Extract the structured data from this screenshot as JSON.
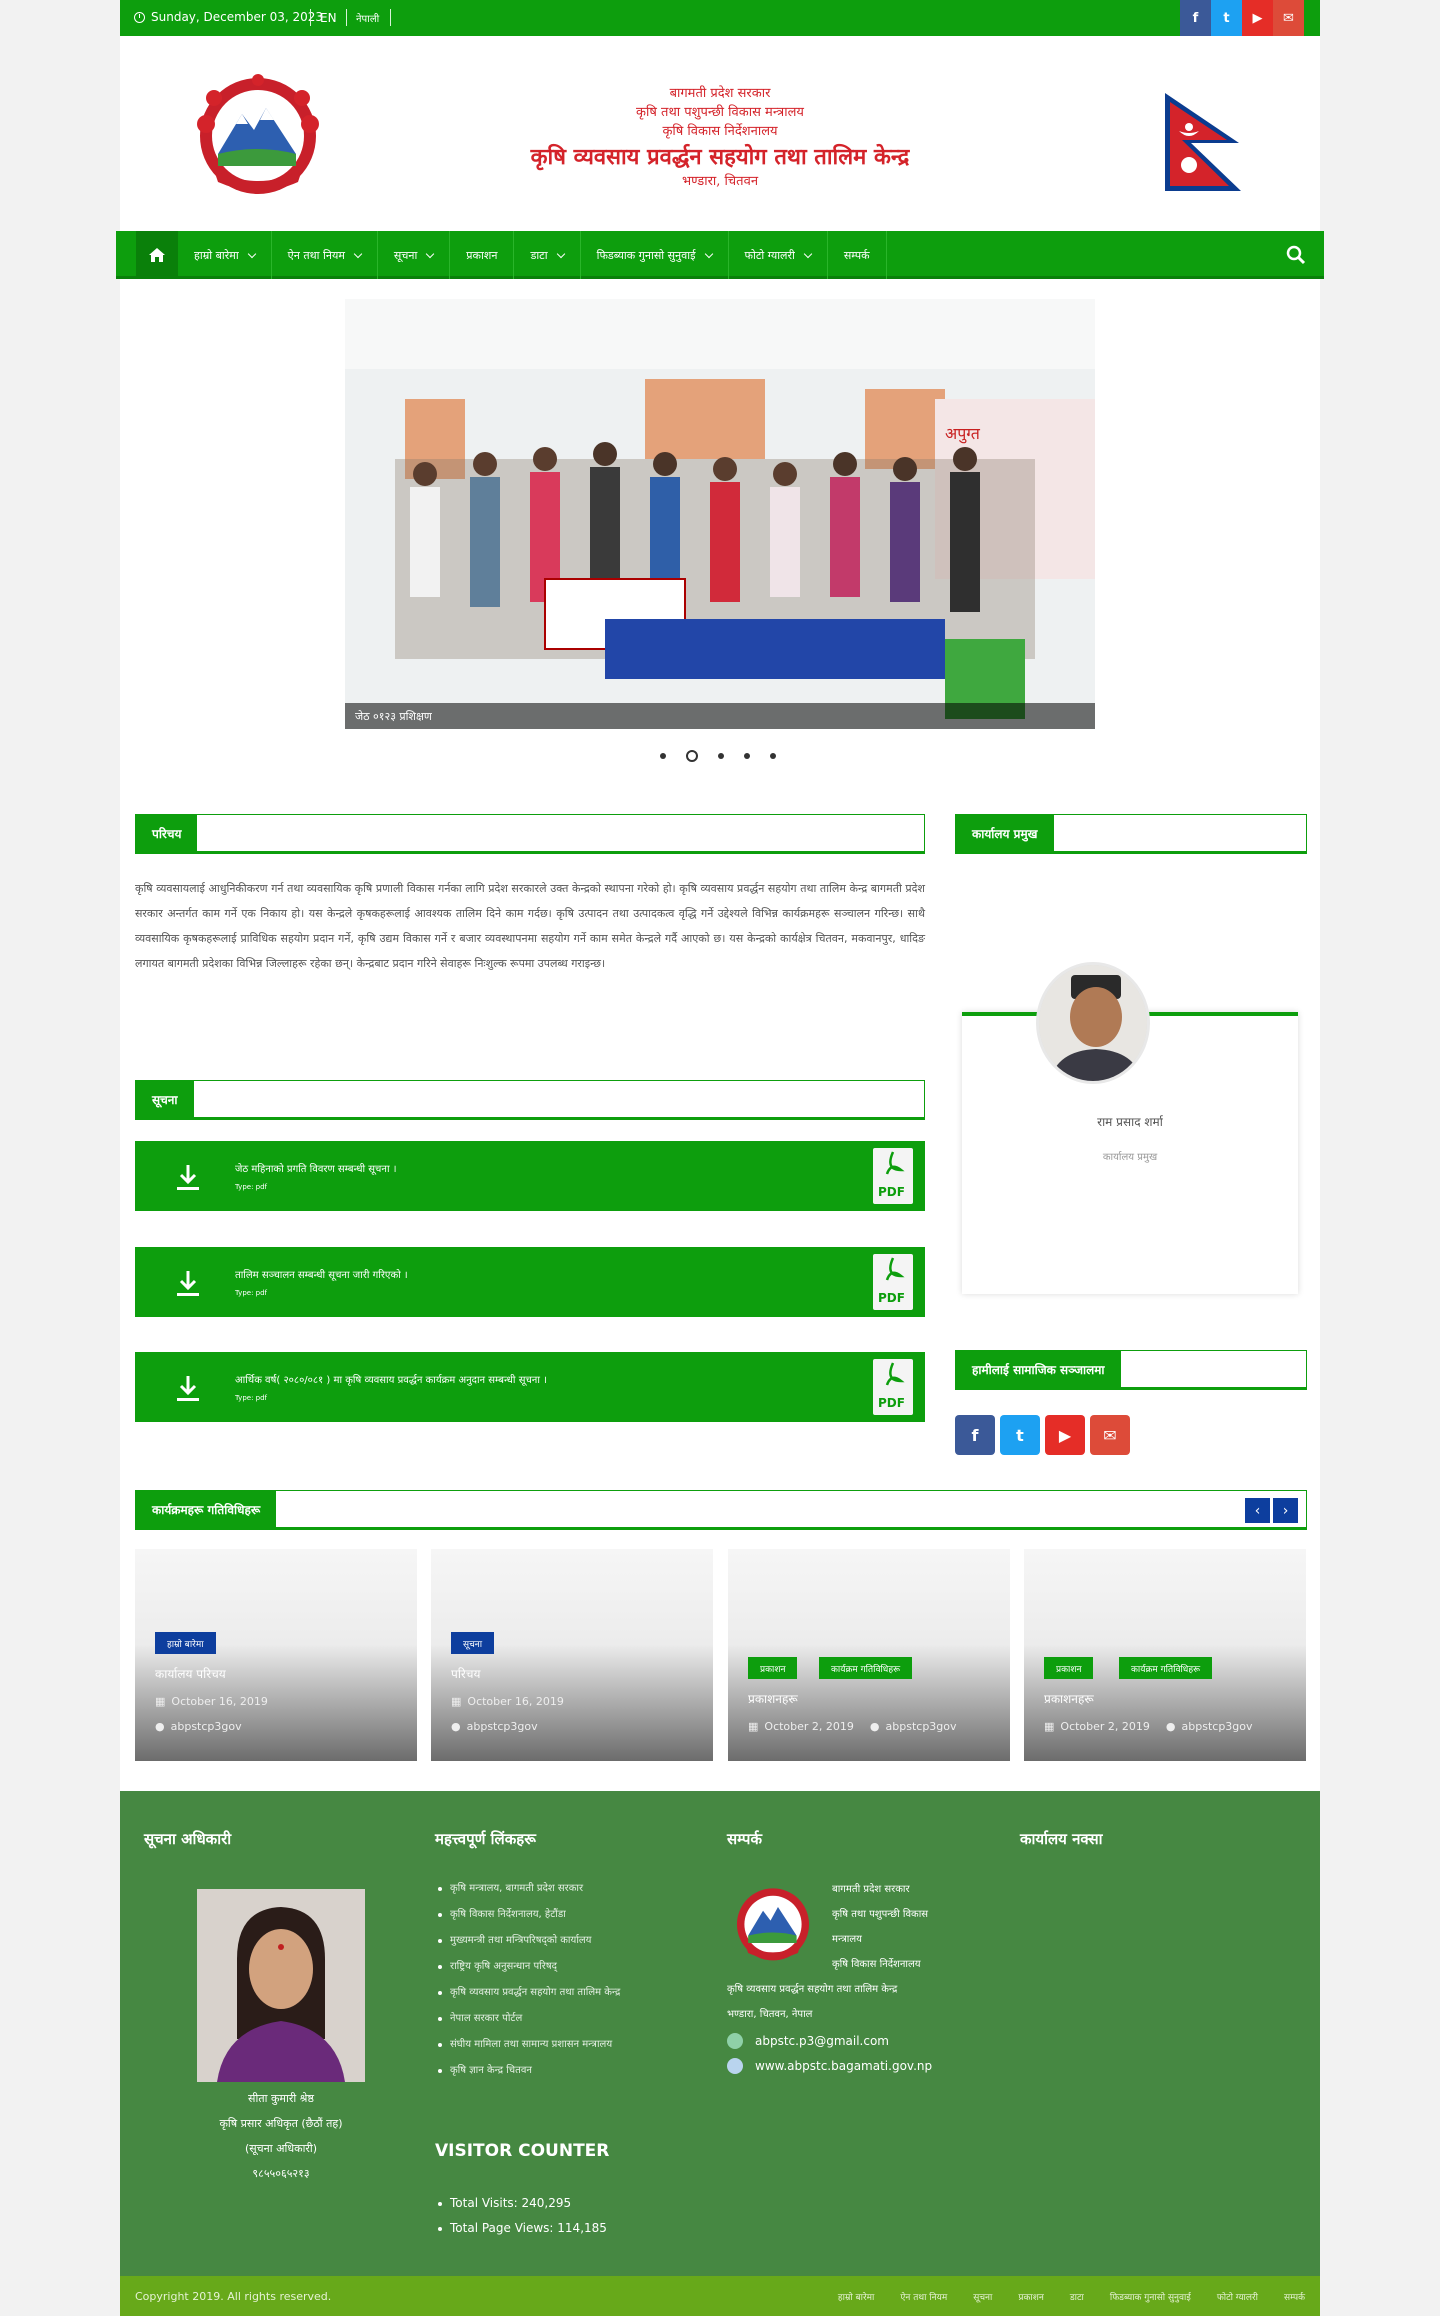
{
  "topbar": {
    "date": "Sunday, December 03, 2023",
    "lang_en": "EN",
    "lang_np": "नेपाली",
    "social": [
      {
        "icon": "facebook-icon",
        "glyph": "f",
        "color": "#3b5998"
      },
      {
        "icon": "twitter-icon",
        "glyph": "t",
        "color": "#1da1f2"
      },
      {
        "icon": "youtube-icon",
        "glyph": "▶",
        "color": "#e52d27"
      },
      {
        "icon": "email-icon",
        "glyph": "✉",
        "color": "#dd4b39"
      }
    ]
  },
  "header": {
    "line1": "बागमती प्रदेश सरकार",
    "line2": "कृषि तथा पशुपन्छी विकास मन्त्रालय",
    "line3": "कृषि विकास निर्देशनालय",
    "line4": "कृषि व्यवसाय प्रवर्द्धन सहयोग तथा तालिम केन्द्र",
    "line5": "भण्डारा, चितवन"
  },
  "nav": {
    "items": [
      {
        "label": "हाम्रो बारेमा",
        "dropdown": true
      },
      {
        "label": "ऐन तथा नियम",
        "dropdown": true
      },
      {
        "label": "सूचना",
        "dropdown": true
      },
      {
        "label": "प्रकाशन",
        "dropdown": false
      },
      {
        "label": "डाटा",
        "dropdown": true
      },
      {
        "label": "फिडब्याक गुनासो सुनुवाई",
        "dropdown": true
      },
      {
        "label": "फोटो ग्यालरी",
        "dropdown": true
      },
      {
        "label": "सम्पर्क",
        "dropdown": false
      }
    ]
  },
  "slider": {
    "caption": "जेठ ०१२३ प्रशिक्षण",
    "active_slide": 2,
    "slides": 5
  },
  "about": {
    "heading": "परिचय",
    "text": "कृषि व्यवसायलाई आधुनिकीकरण गर्न तथा व्यवसायिक कृषि प्रणाली विकास गर्नका लागि प्रदेश सरकारले उक्त केन्द्रको स्थापना गरेको हो। कृषि व्यवसाय प्रवर्द्धन सहयोग तथा तालिम केन्द्र बागमती प्रदेश सरकार अन्तर्गत काम गर्ने एक निकाय हो। यस केन्द्रले कृषकहरूलाई आवश्यक तालिम दिने काम गर्दछ। कृषि उत्पादन तथा उत्पादकत्व वृद्धि गर्ने उद्देश्यले विभिन्न कार्यक्रमहरू सञ्चालन गरिन्छ। साथै व्यवसायिक कृषकहरूलाई प्राविधिक सहयोग प्रदान गर्ने, कृषि उद्यम विकास गर्ने र बजार व्यवस्थापनमा सहयोग गर्ने काम समेत केन्द्रले गर्दै आएको छ। यस केन्द्रको कार्यक्षेत्र चितवन, मकवानपुर, धादिङ लगायत बागमती प्रदेशका विभिन्न जिल्लाहरू रहेका छन्। केन्द्रबाट प्रदान गरिने सेवाहरू निःशुल्क रूपमा उपलब्ध गराइन्छ।"
  },
  "notices_heading": "सूचना",
  "notices": [
    {
      "title": "जेठ महिनाको प्रगति विवरण सम्बन्धी सूचना ।",
      "type": "Type: pdf"
    },
    {
      "title": "तालिम सञ्चालन सम्बन्धी सूचना जारी गरिएको ।",
      "type": "Type: pdf"
    },
    {
      "title": "आर्थिक वर्ष( २०८०/०८१ ) मा कृषि व्यवसाय प्रवर्द्धन कार्यक्रम अनुदान सम्बन्धी सूचना ।",
      "type": "Type: pdf"
    }
  ],
  "sidebar": {
    "chief_heading": "कार्यालय प्रमुख",
    "chief_name": "राम प्रसाद शर्मा",
    "chief_role": "कार्यालय प्रमुख",
    "social_heading": "हामीलाई सामाजिक सञ्जालमा",
    "social": [
      {
        "icon": "facebook-icon",
        "glyph": "f",
        "color": "#3b5998"
      },
      {
        "icon": "twitter-icon",
        "glyph": "t",
        "color": "#1da1f2"
      },
      {
        "icon": "youtube-icon",
        "glyph": "▶",
        "color": "#e52d27"
      },
      {
        "icon": "email-icon",
        "glyph": "✉",
        "color": "#dd4b39"
      }
    ]
  },
  "news_heading": "कार्यक्रमहरू गतिविधिहरू",
  "news_cards": [
    {
      "cats": [
        "हाम्रो बारेमा"
      ],
      "cat_color": "blue",
      "title": "कार्यालय परिचय",
      "date": "October 16, 2019",
      "author": "abpstcp3gov"
    },
    {
      "cats": [
        "सूचना"
      ],
      "cat_color": "blue",
      "title": "परिचय",
      "date": "October 16, 2019",
      "author": "abpstcp3gov"
    },
    {
      "cats": [
        "प्रकाशन",
        "कार्यक्रम गतिविधिहरू"
      ],
      "cat_color": "green",
      "title": "प्रकाशनहरू",
      "date": "October 2, 2019",
      "author": "abpstcp3gov"
    },
    {
      "cats": [
        "प्रकाशन",
        "कार्यक्रम गतिविधिहरू"
      ],
      "cat_color": "green",
      "title": "प्रकाशनहरू",
      "date": "October 2, 2019",
      "author": "abpstcp3gov"
    }
  ],
  "footer": {
    "info_officer_heading": "सूचना अधिकारी",
    "info_officer_name": "सीता कुमारी श्रेष्ठ",
    "info_officer_line2": "कृषि प्रसार अधिकृत (छैठौं तह)",
    "info_officer_line3": "(सूचना अधिकारी)",
    "info_officer_phone": "९८५५०६५२१३",
    "links_heading": "महत्त्वपूर्ण लिंकहरू",
    "links": [
      "कृषि मन्त्रालय, बागमती प्रदेश सरकार",
      "कृषि विकास निर्देशनालय, हेटौंडा",
      "मुख्यमन्त्री तथा मन्त्रिपरिषद्को कार्यालय",
      "राष्ट्रिय कृषि अनुसन्धान परिषद्",
      "कृषि व्यवसाय प्रवर्द्धन सहयोग तथा तालिम केन्द्र",
      "नेपाल सरकार पोर्टल",
      "संघीय मामिला तथा सामान्य प्रशासन मन्त्रालय",
      "कृषि ज्ञान केन्द्र चितवन"
    ],
    "contact_heading": "सम्पर्क",
    "contact_lines": [
      "बागमती प्रदेश सरकार",
      "कृषि तथा पशुपन्छी विकास",
      "मन्त्रालय",
      "कृषि विकास निर्देशनालय",
      "कृषि व्यवसाय प्रवर्द्धन सहयोग तथा तालिम केन्द्र",
      "भण्डारा, चितवन, नेपाल"
    ],
    "email": "abpstc.p3@gmail.com",
    "website": "www.abpstc.bagamati.gov.np",
    "map_heading": "कार्यालय नक्सा",
    "visitor_heading": "VISITOR COUNTER",
    "total_visits": "Total Visits: 240,295",
    "total_page_views": "Total Page Views: 114,185"
  },
  "copyright": {
    "text": "Copyright 2019. All rights reserved.",
    "links": [
      "हाम्रो बारेमा",
      "ऐन तथा नियम",
      "सूचना",
      "प्रकाशन",
      "डाटा",
      "फिडब्याक गुनासो सुनुवाई",
      "फोटो ग्यालरी",
      "सम्पर्क"
    ]
  }
}
